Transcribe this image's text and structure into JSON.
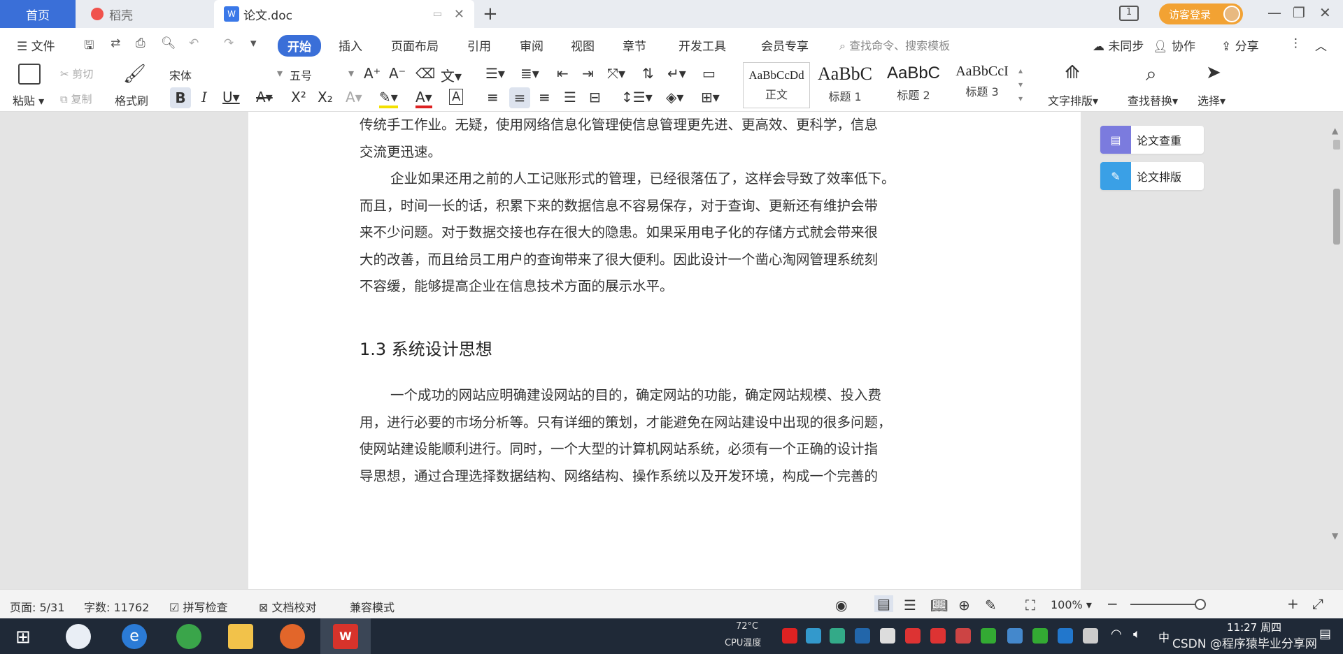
{
  "titlebar": {
    "tab_home": "首页",
    "tab_daoke": "稻壳",
    "tab_doc": "论文.doc",
    "new_tab": "+",
    "page_indicator": "1",
    "login": "访客登录"
  },
  "menu": {
    "file": "文件",
    "items": [
      "开始",
      "插入",
      "页面布局",
      "引用",
      "审阅",
      "视图",
      "章节",
      "开发工具",
      "会员专享"
    ],
    "search_placeholder": "查找命令、搜索模板",
    "sync": "未同步",
    "collab": "协作",
    "share": "分享"
  },
  "ribbon": {
    "paste": "粘贴",
    "cut": "剪切",
    "copy": "复制",
    "format_painter": "格式刷",
    "font_name": "宋体",
    "font_size": "五号",
    "styles": [
      {
        "sample": "AaBbCcDd",
        "name": "正文"
      },
      {
        "sample": "AaBbC",
        "name": "标题 1"
      },
      {
        "sample": "AaBbC",
        "name": "标题 2"
      },
      {
        "sample": "AaBbCcI",
        "name": "标题 3"
      }
    ],
    "text_layout": "文字排版",
    "find_replace": "查找替换",
    "select": "选择"
  },
  "document": {
    "p1_line1": "传统手工作业。无疑，使用网络信息化管理使信息管理更先进、更高效、更科学，信息",
    "p1_line2": "交流更迅速。",
    "p2_line1": "企业如果还用之前的人工记账形式的管理，已经很落伍了，这样会导致了效率低下。",
    "p2_line2": "而且，时间一长的话，积累下来的数据信息不容易保存，对于查询、更新还有维护会带",
    "p2_line3": "来不少问题。对于数据交接也存在很大的隐患。如果采用电子化的存储方式就会带来很",
    "p2_line4": "大的改善，而且给员工用户的查询带来了很大便利。因此设计一个凿心淘网管理系统刻",
    "p2_line5": "不容缓，能够提高企业在信息技术方面的展示水平。",
    "heading": "1.3 系统设计思想",
    "p3_line1": "一个成功的网站应明确建设网站的目的，确定网站的功能，确定网站规模、投入费",
    "p3_line2": "用，进行必要的市场分析等。只有详细的策划，才能避免在网站建设中出现的很多问题，",
    "p3_line3": "使网站建设能顺利进行。同时，一个大型的计算机网站系统，必须有一个正确的设计指",
    "p3_line4": "导思想，通过合理选择数据结构、网络结构、操作系统以及开发环境，构成一个完善的"
  },
  "side_panel": {
    "check": "论文查重",
    "layout": "论文排版"
  },
  "status": {
    "page": "页面: 5/31",
    "words": "字数: 11762",
    "spell": "拼写检查",
    "proof": "文档校对",
    "compat": "兼容模式",
    "zoom": "100%"
  },
  "taskbar": {
    "weather": "72°C",
    "cpu": "CPU温度",
    "time": "11:27 周四",
    "watermark": "CSDN @程序猿毕业分享网"
  },
  "colors": {
    "accent": "#3a6fd8",
    "login": "#f2a233",
    "taskbar": "#1f2937"
  }
}
